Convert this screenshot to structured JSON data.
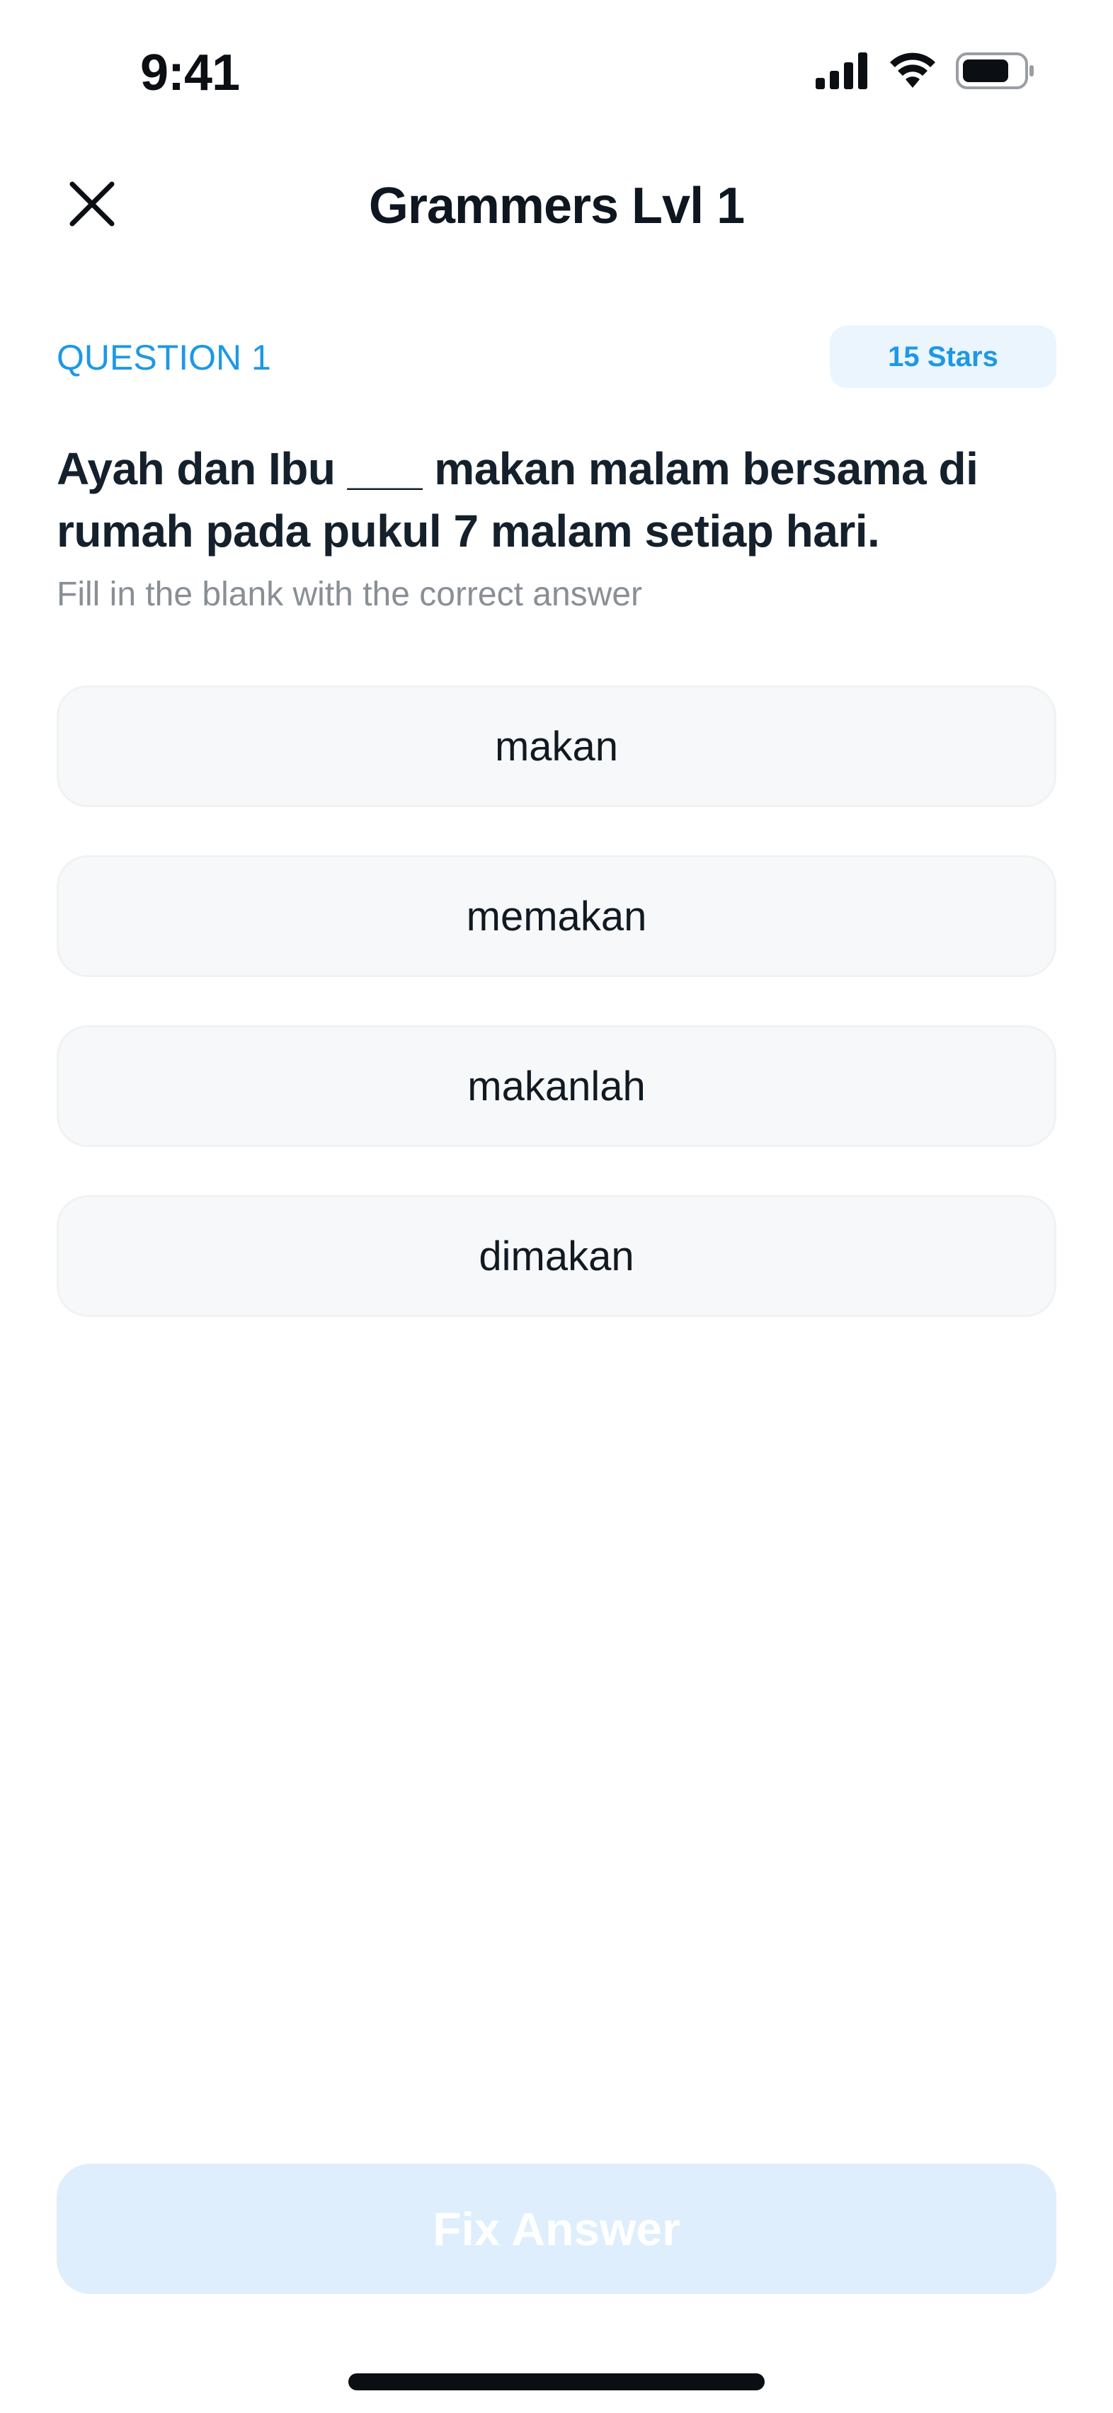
{
  "status_bar": {
    "time": "9:41",
    "icons": [
      "cellular-signal-icon",
      "wifi-icon",
      "battery-icon"
    ]
  },
  "header": {
    "title": "Grammers Lvl 1",
    "close_icon": "close-icon"
  },
  "question": {
    "label": "QUESTION 1",
    "stars": "15 Stars",
    "text": "Ayah dan Ibu ___ makan malam bersama di rumah pada pukul 7 malam setiap hari.",
    "hint": "Fill in the blank with the correct answer"
  },
  "options": [
    {
      "label": "makan"
    },
    {
      "label": "memakan"
    },
    {
      "label": "makanlah"
    },
    {
      "label": "dimakan"
    }
  ],
  "footer": {
    "fix_button_label": "Fix Answer"
  },
  "colors": {
    "accent": "#1e98e6",
    "badge_bg": "#eaf5fd",
    "option_bg": "#f7f8f9",
    "button_disabled_bg": "#deeefc"
  }
}
